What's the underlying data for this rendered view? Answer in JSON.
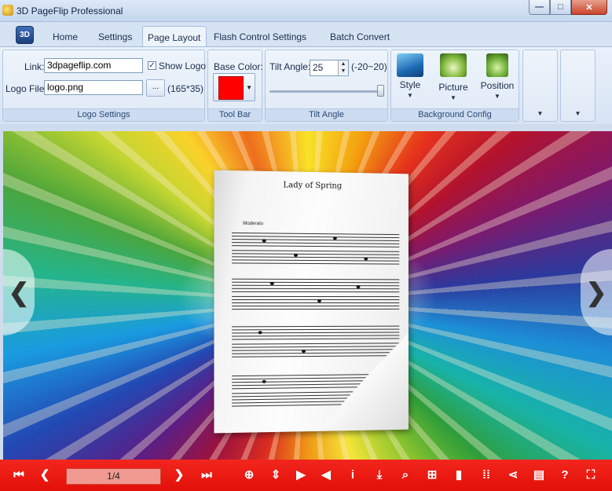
{
  "window": {
    "title": "3D PageFlip Professional",
    "minimize": "—",
    "maximize": "□",
    "close": "✕"
  },
  "menu": {
    "logo": "3D",
    "tabs": [
      {
        "label": "Home"
      },
      {
        "label": "Settings"
      },
      {
        "label": "Page Layout",
        "active": true
      },
      {
        "label": "Flash Control Settings"
      },
      {
        "label": "Batch Convert"
      }
    ]
  },
  "ribbon": {
    "logo_settings": {
      "group_label": "Logo Settings",
      "link_label": "Link:",
      "link_value": "3dpageflip.com",
      "show_logo_label": "Show Logo",
      "show_logo_checked": true,
      "logo_file_label": "Logo File:",
      "logo_file_value": "logo.png",
      "browse_label": "...",
      "size_hint": "(165*35)"
    },
    "tool_bar": {
      "group_label": "Tool Bar",
      "base_color_label": "Base Color:",
      "base_color": "#ff0000"
    },
    "tilt_angle": {
      "group_label": "Tilt Angle",
      "label": "Tilt Angle:",
      "value": "25",
      "range_hint": "(-20~20)"
    },
    "background_config": {
      "group_label": "Background Config",
      "style_label": "Style",
      "picture_label": "Picture",
      "position_label": "Position"
    }
  },
  "book": {
    "page_title": "Lady of Spring",
    "composer_note": "Moderato",
    "nav_prev": "❮",
    "nav_next": "❯"
  },
  "toolbar": {
    "page_indicator": "1/4",
    "icons": [
      "first-page-icon",
      "prev-page-icon",
      "next-page-icon",
      "last-page-icon",
      "zoom-in-icon",
      "fit-icon",
      "play-icon",
      "sound-icon",
      "info-icon",
      "download-icon",
      "search-icon",
      "toc-icon",
      "bookmark-icon",
      "thumbnails-icon",
      "share-icon",
      "print-icon",
      "help-icon",
      "fullscreen-icon"
    ],
    "accent": "#e8150c"
  }
}
